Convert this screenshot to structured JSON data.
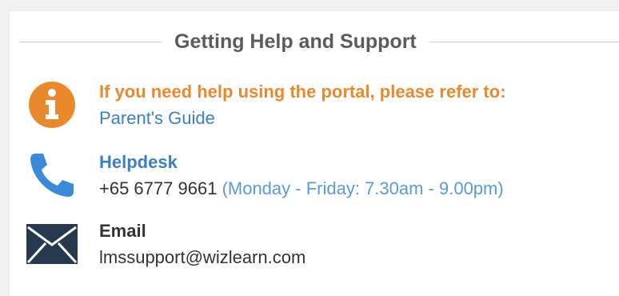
{
  "section": {
    "title": "Getting Help and Support"
  },
  "portal_help": {
    "heading": "If you need help using the portal, please refer to:",
    "link_label": "Parent's Guide",
    "icon": "info-icon"
  },
  "helpdesk": {
    "heading": "Helpdesk",
    "phone": "+65 6777 9661",
    "hours": "(Monday - Friday: 7.30am - 9.00pm)",
    "icon": "phone-icon"
  },
  "email": {
    "heading": "Email",
    "address": "lmssupport@wizlearn.com",
    "icon": "envelope-icon"
  },
  "colors": {
    "accent_orange": "#e9892b",
    "link_blue": "#3a7fc8",
    "icon_navy": "#27394f"
  }
}
